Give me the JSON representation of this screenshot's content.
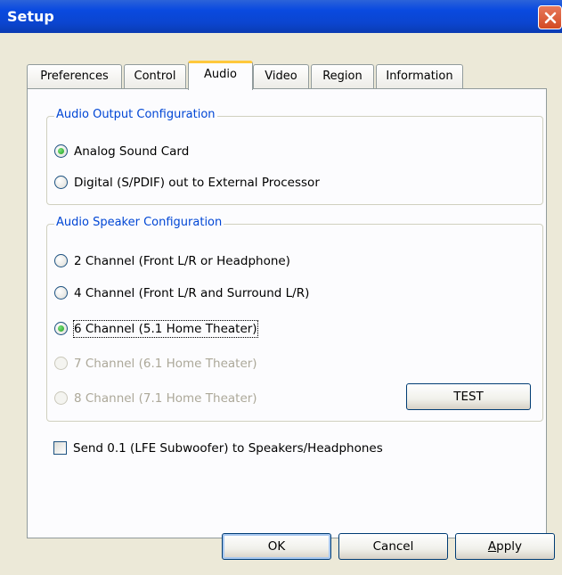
{
  "window": {
    "title": "Setup"
  },
  "tabs": [
    {
      "label": "Preferences",
      "active": false
    },
    {
      "label": "Control",
      "active": false
    },
    {
      "label": "Audio",
      "active": true
    },
    {
      "label": "Video",
      "active": false
    },
    {
      "label": "Region",
      "active": false
    },
    {
      "label": "Information",
      "active": false
    }
  ],
  "output_group": {
    "legend": "Audio Output Configuration",
    "options": [
      {
        "label": "Analog Sound Card",
        "selected": true,
        "enabled": true
      },
      {
        "label": "Digital (S/PDIF) out to External Processor",
        "selected": false,
        "enabled": true
      }
    ]
  },
  "speaker_group": {
    "legend": "Audio Speaker Configuration",
    "options": [
      {
        "label": "2 Channel (Front L/R or Headphone)",
        "selected": false,
        "enabled": true
      },
      {
        "label": "4 Channel (Front L/R and Surround L/R)",
        "selected": false,
        "enabled": true
      },
      {
        "label": "6 Channel (5.1 Home Theater)",
        "selected": true,
        "enabled": true
      },
      {
        "label": "7 Channel (6.1 Home Theater)",
        "selected": false,
        "enabled": false
      },
      {
        "label": "8 Channel (7.1 Home Theater)",
        "selected": false,
        "enabled": false
      }
    ],
    "test_button": "TEST"
  },
  "lfe_checkbox": {
    "label": "Send 0.1 (LFE Subwoofer) to Speakers/Headphones",
    "checked": false
  },
  "footer": {
    "ok": "OK",
    "cancel": "Cancel",
    "apply": "Apply"
  },
  "colors": {
    "titlebar": "#0a4ae0",
    "group_legend": "#0046d5",
    "tab_highlight": "#ffc83c",
    "close": "#d34a23"
  }
}
